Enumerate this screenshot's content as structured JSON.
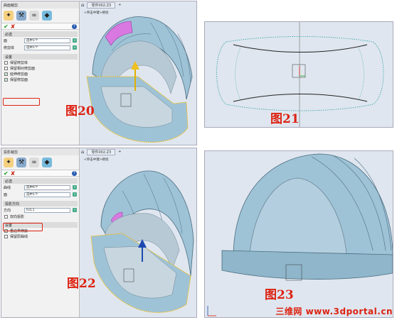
{
  "panel_a": {
    "dialog_title": "曲面裁剪",
    "section_required": "必选",
    "row1_label": "面",
    "row1_value": "选中1个",
    "row2_label": "修剪体",
    "row2_value": "选中1个",
    "section_settings": "设置",
    "opt1": "保留修剪体",
    "opt2": "保留相对修剪面",
    "opt3": "延伸修剪面",
    "opt4": "保留修剪面",
    "tab_label": "零件002.Z3",
    "breadcrumb": "<单击中键>继续",
    "figure_label": "图20"
  },
  "panel_b": {
    "figure_label": "图21"
  },
  "panel_c": {
    "dialog_title": "投影裁剪",
    "section_required": "必选",
    "row1_label": "曲线",
    "row1_value": "选中6个",
    "row2_label": "面",
    "row2_value": "选中1个",
    "section_projection": "投影方向",
    "dir_label": "方向",
    "dir_value": "0,0,1",
    "opt_bidirectional": "双向投影",
    "section_settings": "设置",
    "opt1": "重边界修剪",
    "opt2": "保留原曲线",
    "tab_label": "零件002.Z3",
    "breadcrumb": "<单击中键>继续",
    "figure_label": "图22"
  },
  "panel_d": {
    "figure_label": "图23"
  },
  "watermark": "三维网 www.3dportal.cn",
  "colors": {
    "surface": "#9fc3d6",
    "highlight_red": "#dd2211",
    "selection_yellow": "#f0c020",
    "magenta": "#d978e0"
  }
}
